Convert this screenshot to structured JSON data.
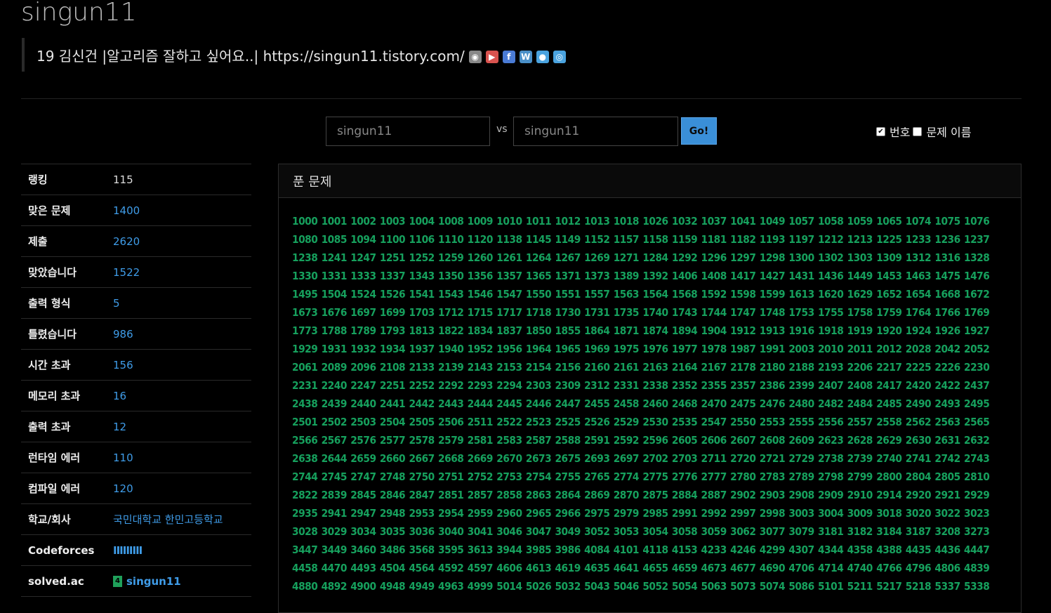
{
  "header": {
    "username": "singun11",
    "bio": "19 김신건 |알고리즘 잘하고 싶어요..| https://singun11.tistory.com/",
    "social_icons": [
      {
        "name": "github-icon",
        "glyph": "◉",
        "color": "#888"
      },
      {
        "name": "youtube-icon",
        "glyph": "▶",
        "color": "#d9534f"
      },
      {
        "name": "facebook-icon",
        "glyph": "f",
        "color": "#4a7bd5"
      },
      {
        "name": "wordpress-icon",
        "glyph": "W",
        "color": "#4a8fc7"
      },
      {
        "name": "globe-icon",
        "glyph": "●",
        "color": "#4aa3df"
      },
      {
        "name": "instagram-icon",
        "glyph": "◎",
        "color": "#4aa3df"
      }
    ]
  },
  "compare": {
    "left_value": "singun11",
    "vs_label": "vs",
    "right_value": "singun11",
    "go_label": "Go!",
    "opt_number_label": "번호",
    "opt_name_label": "문제 이름"
  },
  "stats": [
    {
      "label": "랭킹",
      "value": "115",
      "link": false
    },
    {
      "label": "맞은 문제",
      "value": "1400",
      "link": true
    },
    {
      "label": "제출",
      "value": "2620",
      "link": true
    },
    {
      "label": "맞았습니다",
      "value": "1522",
      "link": true
    },
    {
      "label": "출력 형식",
      "value": "5",
      "link": true
    },
    {
      "label": "틀렸습니다",
      "value": "986",
      "link": true
    },
    {
      "label": "시간 초과",
      "value": "156",
      "link": true
    },
    {
      "label": "메모리 초과",
      "value": "16",
      "link": true
    },
    {
      "label": "출력 초과",
      "value": "12",
      "link": true
    },
    {
      "label": "런타임 에러",
      "value": "110",
      "link": true
    },
    {
      "label": "컴파일 에러",
      "value": "120",
      "link": true
    },
    {
      "label": "학교/회사",
      "value": "국민대학교 한민고등학교",
      "link": true
    },
    {
      "label": "Codeforces",
      "value": "IIIIIIIII",
      "link": true
    },
    {
      "label": "solved.ac",
      "value": "singun11",
      "link": true
    }
  ],
  "solved_panel": {
    "title": "푼 문제",
    "problems": [
      "1000",
      "1001",
      "1002",
      "1003",
      "1004",
      "1008",
      "1009",
      "1010",
      "1011",
      "1012",
      "1013",
      "1018",
      "1026",
      "1032",
      "1037",
      "1041",
      "1049",
      "1057",
      "1058",
      "1059",
      "1065",
      "1074",
      "1075",
      "1076",
      "1080",
      "1085",
      "1094",
      "1100",
      "1106",
      "1110",
      "1120",
      "1138",
      "1145",
      "1149",
      "1152",
      "1157",
      "1158",
      "1159",
      "1181",
      "1182",
      "1193",
      "1197",
      "1212",
      "1213",
      "1225",
      "1233",
      "1236",
      "1237",
      "1238",
      "1241",
      "1247",
      "1251",
      "1252",
      "1259",
      "1260",
      "1261",
      "1264",
      "1267",
      "1269",
      "1271",
      "1284",
      "1292",
      "1296",
      "1297",
      "1298",
      "1300",
      "1302",
      "1303",
      "1309",
      "1312",
      "1316",
      "1328",
      "1330",
      "1331",
      "1333",
      "1337",
      "1343",
      "1350",
      "1356",
      "1357",
      "1365",
      "1371",
      "1373",
      "1389",
      "1392",
      "1406",
      "1408",
      "1417",
      "1427",
      "1431",
      "1436",
      "1449",
      "1453",
      "1463",
      "1475",
      "1476",
      "1495",
      "1504",
      "1524",
      "1526",
      "1541",
      "1543",
      "1546",
      "1547",
      "1550",
      "1551",
      "1557",
      "1563",
      "1564",
      "1568",
      "1592",
      "1598",
      "1599",
      "1613",
      "1620",
      "1629",
      "1652",
      "1654",
      "1668",
      "1672",
      "1673",
      "1676",
      "1697",
      "1699",
      "1703",
      "1712",
      "1715",
      "1717",
      "1718",
      "1730",
      "1731",
      "1735",
      "1740",
      "1743",
      "1744",
      "1747",
      "1748",
      "1753",
      "1755",
      "1758",
      "1759",
      "1764",
      "1766",
      "1769",
      "1773",
      "1788",
      "1789",
      "1793",
      "1813",
      "1822",
      "1834",
      "1837",
      "1850",
      "1855",
      "1864",
      "1871",
      "1874",
      "1894",
      "1904",
      "1912",
      "1913",
      "1916",
      "1918",
      "1919",
      "1920",
      "1924",
      "1926",
      "1927",
      "1929",
      "1931",
      "1932",
      "1934",
      "1937",
      "1940",
      "1952",
      "1956",
      "1964",
      "1965",
      "1969",
      "1975",
      "1976",
      "1977",
      "1978",
      "1987",
      "1991",
      "2003",
      "2010",
      "2011",
      "2012",
      "2028",
      "2042",
      "2052",
      "2061",
      "2089",
      "2096",
      "2108",
      "2133",
      "2139",
      "2143",
      "2153",
      "2154",
      "2156",
      "2160",
      "2161",
      "2163",
      "2164",
      "2167",
      "2178",
      "2180",
      "2188",
      "2193",
      "2206",
      "2217",
      "2225",
      "2226",
      "2230",
      "2231",
      "2240",
      "2247",
      "2251",
      "2252",
      "2292",
      "2293",
      "2294",
      "2303",
      "2309",
      "2312",
      "2331",
      "2338",
      "2352",
      "2355",
      "2357",
      "2386",
      "2399",
      "2407",
      "2408",
      "2417",
      "2420",
      "2422",
      "2437",
      "2438",
      "2439",
      "2440",
      "2441",
      "2442",
      "2443",
      "2444",
      "2445",
      "2446",
      "2447",
      "2455",
      "2458",
      "2460",
      "2468",
      "2470",
      "2475",
      "2476",
      "2480",
      "2482",
      "2484",
      "2485",
      "2490",
      "2493",
      "2495",
      "2501",
      "2502",
      "2503",
      "2504",
      "2505",
      "2506",
      "2511",
      "2522",
      "2523",
      "2525",
      "2526",
      "2529",
      "2530",
      "2535",
      "2547",
      "2550",
      "2553",
      "2555",
      "2556",
      "2557",
      "2558",
      "2562",
      "2563",
      "2565",
      "2566",
      "2567",
      "2576",
      "2577",
      "2578",
      "2579",
      "2581",
      "2583",
      "2587",
      "2588",
      "2591",
      "2592",
      "2596",
      "2605",
      "2606",
      "2607",
      "2608",
      "2609",
      "2623",
      "2628",
      "2629",
      "2630",
      "2631",
      "2632",
      "2638",
      "2644",
      "2659",
      "2660",
      "2667",
      "2668",
      "2669",
      "2670",
      "2673",
      "2675",
      "2693",
      "2697",
      "2702",
      "2703",
      "2711",
      "2720",
      "2721",
      "2729",
      "2738",
      "2739",
      "2740",
      "2741",
      "2742",
      "2743",
      "2744",
      "2745",
      "2747",
      "2748",
      "2750",
      "2751",
      "2752",
      "2753",
      "2754",
      "2755",
      "2765",
      "2774",
      "2775",
      "2776",
      "2777",
      "2780",
      "2783",
      "2789",
      "2798",
      "2799",
      "2800",
      "2804",
      "2805",
      "2810",
      "2822",
      "2839",
      "2845",
      "2846",
      "2847",
      "2851",
      "2857",
      "2858",
      "2863",
      "2864",
      "2869",
      "2870",
      "2875",
      "2884",
      "2887",
      "2902",
      "2903",
      "2908",
      "2909",
      "2910",
      "2914",
      "2920",
      "2921",
      "2929",
      "2935",
      "2941",
      "2947",
      "2948",
      "2953",
      "2954",
      "2959",
      "2960",
      "2965",
      "2966",
      "2975",
      "2979",
      "2985",
      "2991",
      "2992",
      "2997",
      "2998",
      "3003",
      "3004",
      "3009",
      "3018",
      "3020",
      "3022",
      "3023",
      "3028",
      "3029",
      "3034",
      "3035",
      "3036",
      "3040",
      "3041",
      "3046",
      "3047",
      "3049",
      "3052",
      "3053",
      "3054",
      "3058",
      "3059",
      "3062",
      "3077",
      "3079",
      "3181",
      "3182",
      "3184",
      "3187",
      "3208",
      "3273",
      "3447",
      "3449",
      "3460",
      "3486",
      "3568",
      "3595",
      "3613",
      "3944",
      "3985",
      "3986",
      "4084",
      "4101",
      "4118",
      "4153",
      "4233",
      "4246",
      "4299",
      "4307",
      "4344",
      "4358",
      "4388",
      "4435",
      "4436",
      "4447",
      "4458",
      "4470",
      "4493",
      "4504",
      "4564",
      "4592",
      "4597",
      "4606",
      "4613",
      "4619",
      "4635",
      "4641",
      "4655",
      "4659",
      "4673",
      "4677",
      "4690",
      "4706",
      "4714",
      "4740",
      "4766",
      "4796",
      "4806",
      "4839",
      "4880",
      "4892",
      "4900",
      "4948",
      "4949",
      "4963",
      "4999",
      "5014",
      "5026",
      "5032",
      "5043",
      "5046",
      "5052",
      "5054",
      "5063",
      "5073",
      "5074",
      "5086",
      "5101",
      "5211",
      "5217",
      "5218",
      "5337",
      "5338"
    ]
  }
}
